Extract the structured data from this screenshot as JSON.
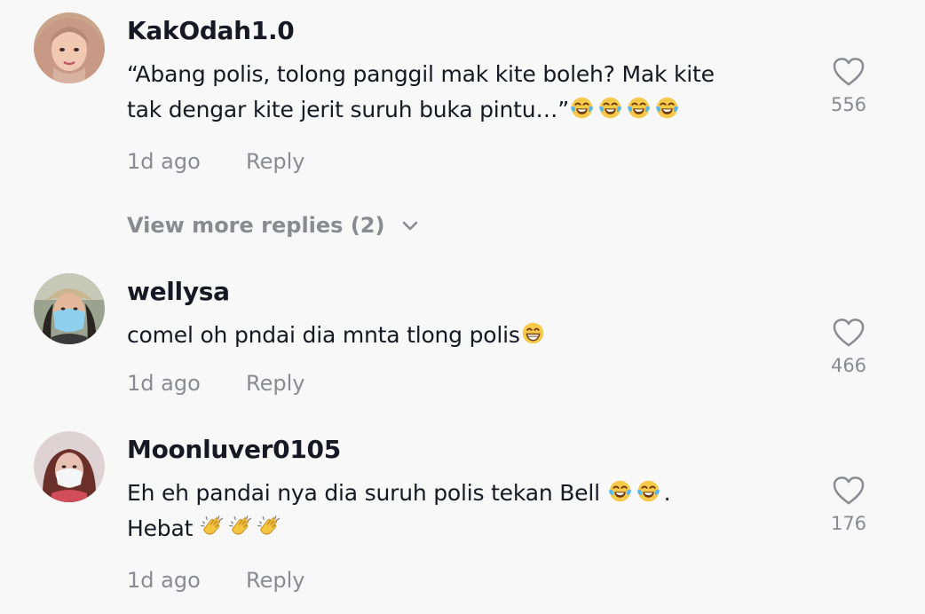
{
  "comments": [
    {
      "username": "KakOdah1.0",
      "text_lines": [
        "“Abang polis, tolong panggil mak kite boleh? Mak kite",
        "tak dengar kite jerit suruh buka pintu…”"
      ],
      "line2_emojis": [
        "face-with-tears-of-joy-emoji",
        "face-with-tears-of-joy-emoji",
        "face-with-tears-of-joy-emoji",
        "face-with-tears-of-joy-emoji"
      ],
      "time": "1d ago",
      "reply_label": "Reply",
      "likes": "556",
      "view_more": "View more replies (2)"
    },
    {
      "username": "wellysa",
      "text_lines": [
        "comel oh pndai dia mnta tlong polis"
      ],
      "line1_emojis": [
        "beaming-face-emoji"
      ],
      "time": "1d ago",
      "reply_label": "Reply",
      "likes": "466"
    },
    {
      "username": "Moonluver0105",
      "text_lines": [
        "Eh eh pandai nya dia suruh polis tekan Bell ",
        "Hebat "
      ],
      "line1_suffix": ".",
      "line1_emojis": [
        "face-with-tears-of-joy-emoji",
        "face-with-tears-of-joy-emoji"
      ],
      "line2_emojis": [
        "clapping-hands-emoji",
        "clapping-hands-emoji",
        "clapping-hands-emoji"
      ],
      "time": "1d ago",
      "reply_label": "Reply",
      "likes": "176"
    }
  ],
  "icons": {
    "like": "heart-outline-icon",
    "expand": "chevron-down-icon"
  },
  "colors": {
    "background": "#f8f8f8",
    "text": "#161823",
    "muted": "#8a8b91"
  }
}
